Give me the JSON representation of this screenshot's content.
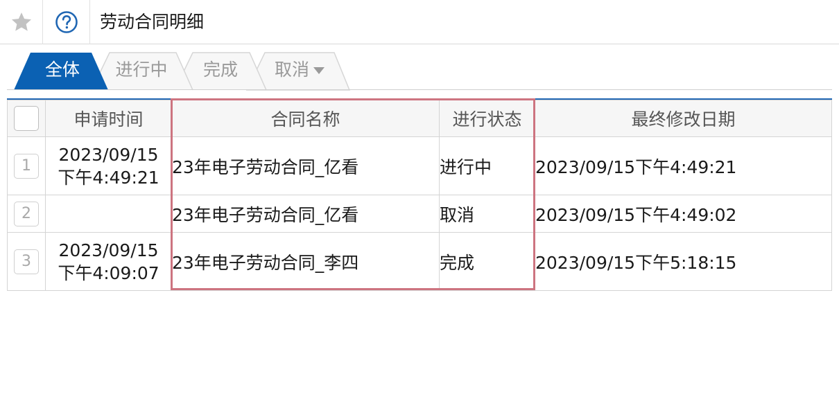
{
  "header": {
    "title": "劳动合同明细",
    "star_icon": "star-icon",
    "help_icon": "help-circle-icon"
  },
  "tabs": [
    {
      "label": "全体",
      "active": true
    },
    {
      "label": "进行中",
      "active": false
    },
    {
      "label": "完成",
      "active": false
    },
    {
      "label": "取消",
      "active": false,
      "has_dropdown": true
    }
  ],
  "colors": {
    "accent": "#0b61b3",
    "highlight_border": "#cd7480",
    "header_bg": "#f6f6f6"
  },
  "table": {
    "columns": [
      "申请时间",
      "合同名称",
      "进行状态",
      "最终修改日期"
    ],
    "rows": [
      {
        "num": "1",
        "apply_date": "2023/09/15",
        "apply_time": "下午4:49:21",
        "name": "23年电子劳动合同_亿看",
        "status": "进行中",
        "modified": "2023/09/15下午4:49:21"
      },
      {
        "num": "2",
        "apply_date": "",
        "apply_time": "",
        "name": "23年电子劳动合同_亿看",
        "status": "取消",
        "modified": "2023/09/15下午4:49:02"
      },
      {
        "num": "3",
        "apply_date": "2023/09/15",
        "apply_time": "下午4:09:07",
        "name": "23年电子劳动合同_李四",
        "status": "完成",
        "modified": "2023/09/15下午5:18:15"
      }
    ]
  }
}
